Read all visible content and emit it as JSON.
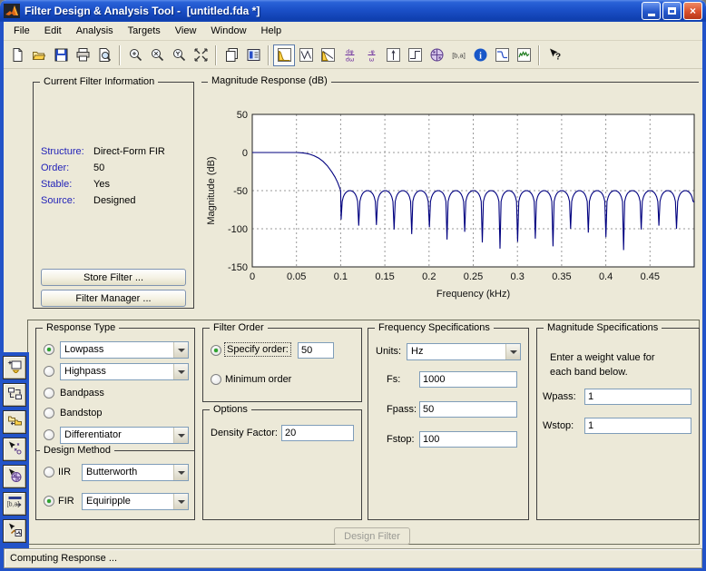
{
  "window": {
    "title": "Filter Design & Analysis Tool -  [untitled.fda *]",
    "controls": {
      "minimize": "minimize",
      "maximize": "maximize",
      "close": "close"
    }
  },
  "menu": {
    "items": [
      "File",
      "Edit",
      "Analysis",
      "Targets",
      "View",
      "Window",
      "Help"
    ]
  },
  "toolbar": {
    "buttons": [
      {
        "name": "new-session",
        "icon": "page"
      },
      {
        "name": "open-session",
        "icon": "folder"
      },
      {
        "name": "save-session",
        "icon": "floppy"
      },
      {
        "name": "print",
        "icon": "printer"
      },
      {
        "name": "print-preview",
        "icon": "preview"
      },
      {
        "sep": true
      },
      {
        "name": "zoom-in",
        "icon": "mag-plus"
      },
      {
        "name": "zoom-x",
        "icon": "mag-x"
      },
      {
        "name": "zoom-y",
        "icon": "mag-y"
      },
      {
        "name": "full-view",
        "icon": "full-view"
      },
      {
        "sep": true
      },
      {
        "name": "print-to-figure",
        "icon": "pages"
      },
      {
        "name": "filter-coefficients-view",
        "icon": "coeff-box"
      },
      {
        "sep": true
      },
      {
        "name": "magnitude-response",
        "icon": "lowpass-yellow",
        "selected": true
      },
      {
        "name": "phase-response",
        "icon": "zigzag"
      },
      {
        "name": "magnitude-and-phase",
        "icon": "lowpass-line"
      },
      {
        "name": "group-delay",
        "icon": "group-delay"
      },
      {
        "name": "phase-delay",
        "icon": "phase-delay"
      },
      {
        "name": "impulse-response",
        "icon": "impulse"
      },
      {
        "name": "step-response",
        "icon": "step"
      },
      {
        "name": "pole-zero-plot",
        "icon": "pz-wheel"
      },
      {
        "name": "filter-coefficients-ba",
        "icon": "ba"
      },
      {
        "name": "filter-information",
        "icon": "info"
      },
      {
        "name": "magnitude-spec-mask",
        "icon": "spec-mask"
      },
      {
        "name": "spectral-estimate",
        "icon": "green-curve"
      },
      {
        "sep": true
      },
      {
        "name": "context-help",
        "icon": "help-arrow"
      }
    ]
  },
  "current_filter_info": {
    "title": "Current Filter Information",
    "rows": [
      {
        "label": "Structure:",
        "value": "Direct-Form FIR"
      },
      {
        "label": "Order:",
        "value": "50"
      },
      {
        "label": "Stable:",
        "value": "Yes"
      },
      {
        "label": "Source:",
        "value": "Designed"
      }
    ],
    "store_button": "Store Filter ...",
    "manager_button": "Filter Manager ..."
  },
  "chart_data": {
    "type": "line",
    "title": "Magnitude Response (dB)",
    "xlabel": "Frequency (kHz)",
    "ylabel": "Magnitude (dB)",
    "xlim": [
      0,
      0.5
    ],
    "ylim": [
      -150,
      50
    ],
    "xticks": [
      "0",
      "0.05",
      "0.1",
      "0.15",
      "0.2",
      "0.25",
      "0.3",
      "0.35",
      "0.4",
      "0.45"
    ],
    "yticks": [
      "50",
      "0",
      "-50",
      "-100",
      "-150"
    ],
    "grid": true,
    "line_color": "#00007f",
    "series": [
      {
        "name": "Lowpass equiripple FIR magnitude response",
        "passband_db": 0,
        "passband_end_khz": 0.05,
        "transition_points": [
          [
            0.05,
            0
          ],
          [
            0.0555,
            -0.3
          ],
          [
            0.06,
            -1
          ],
          [
            0.065,
            -2.3
          ],
          [
            0.07,
            -4.3
          ],
          [
            0.075,
            -7.3
          ],
          [
            0.08,
            -11.5
          ],
          [
            0.085,
            -17.5
          ],
          [
            0.09,
            -25.5
          ],
          [
            0.0935,
            -32
          ],
          [
            0.0965,
            -39
          ],
          [
            0.0985,
            -45
          ],
          [
            0.1,
            -50
          ]
        ],
        "stopband": {
          "peak_db": -50,
          "first_notch_khz": 0.1005,
          "notch_spacing_khz": 0.019975,
          "notch_depths_db": [
            -88,
            -96,
            -95,
            -101,
            -107,
            -98,
            -114,
            -104,
            -118,
            -126,
            -117,
            -113,
            -123,
            -100,
            -105,
            -111,
            -128,
            -101,
            -96,
            -100,
            -65
          ]
        }
      }
    ]
  },
  "design_panel": {
    "response_type": {
      "label": "Response Type",
      "options": [
        {
          "label": "Lowpass",
          "selected": true,
          "combo": true
        },
        {
          "label": "Highpass",
          "selected": false,
          "combo": true
        },
        {
          "label": "Bandpass",
          "selected": false,
          "combo": false
        },
        {
          "label": "Bandstop",
          "selected": false,
          "combo": false
        },
        {
          "label": "Differentiator",
          "selected": false,
          "combo": true
        }
      ]
    },
    "design_method": {
      "label": "Design Method",
      "iir_label": "IIR",
      "iir_value": "Butterworth",
      "iir_selected": false,
      "fir_label": "FIR",
      "fir_value": "Equiripple",
      "fir_selected": true
    },
    "filter_order": {
      "label": "Filter Order",
      "specify_label": "Specify order:",
      "specify_value": "50",
      "specify_selected": true,
      "minimum_label": "Minimum order",
      "minimum_selected": false
    },
    "options": {
      "label": "Options",
      "density_label": "Density Factor:",
      "density_value": "20"
    },
    "frequency_specs": {
      "label": "Frequency Specifications",
      "units_label": "Units:",
      "units_value": "Hz",
      "fs_label": "Fs:",
      "fs_value": "1000",
      "fpass_label": "Fpass:",
      "fpass_value": "50",
      "fstop_label": "Fstop:",
      "fstop_value": "100"
    },
    "magnitude_specs": {
      "label": "Magnitude Specifications",
      "note1": "Enter a weight value for",
      "note2": "each band below.",
      "wpass_label": "Wpass:",
      "wpass_value": "1",
      "wstop_label": "Wstop:",
      "wstop_value": "1"
    },
    "design_button_label": "Design Filter"
  },
  "sidebar": {
    "icons": [
      {
        "name": "create-multirate-filter",
        "icon": "multirate"
      },
      {
        "name": "transform-filter",
        "icon": "transform"
      },
      {
        "name": "import-filter",
        "icon": "import"
      },
      {
        "name": "pole-zero-editor",
        "icon": "pz-editor"
      },
      {
        "name": "set-quantization-parameters",
        "icon": "quantize"
      },
      {
        "name": "export-coefficients",
        "icon": "ba-export"
      },
      {
        "name": "realize-model",
        "icon": "realize"
      }
    ]
  },
  "status_bar": {
    "text": "Computing Response ..."
  },
  "colors": {
    "titlebar_blue": "#1b50c8",
    "frame_blue": "#2253c8",
    "background": "#ece9d8",
    "plot_line": "#00007f",
    "info_label_blue": "#2323b8",
    "radio_green": "#2da32d"
  }
}
